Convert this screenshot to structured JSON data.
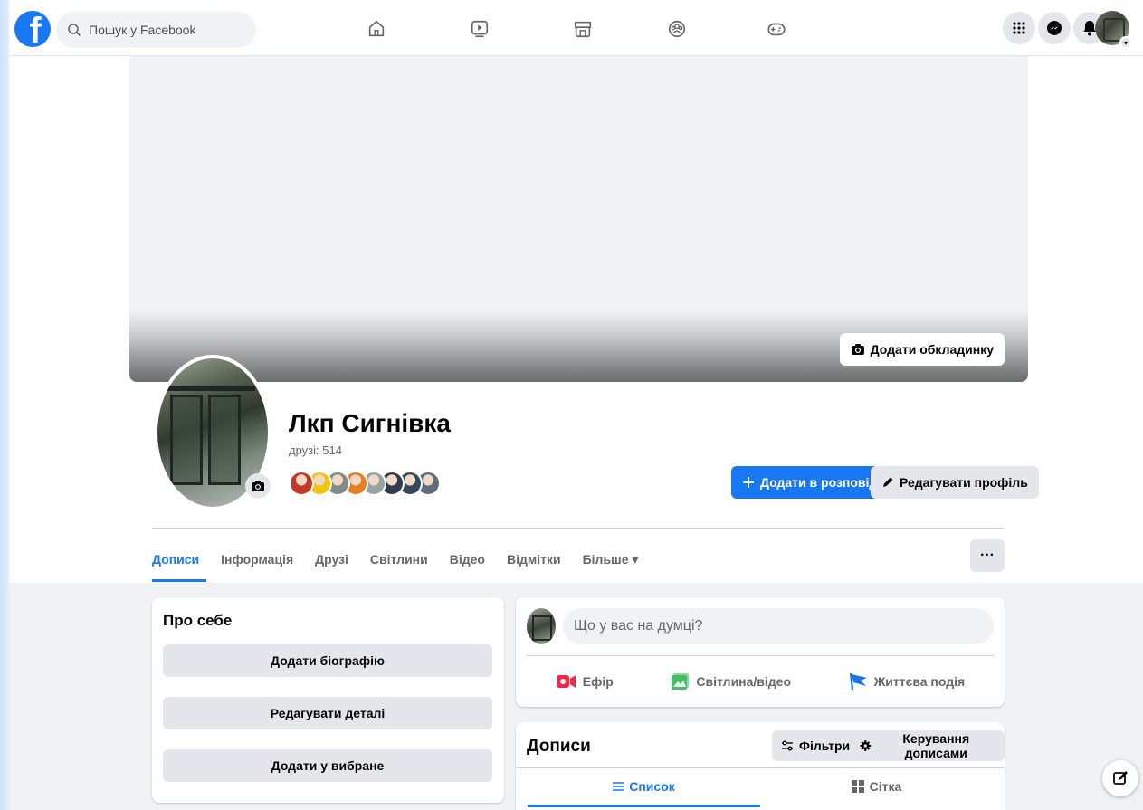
{
  "topbar": {
    "search_placeholder": "Пошук у Facebook",
    "brand_color": "#1877f2"
  },
  "cover": {
    "add_cover_label": "Додати обкладинку"
  },
  "profile": {
    "name": "Лкп Сигнівка",
    "friends_count": "друзі: 514",
    "friend_face_colors": [
      "#c0392b",
      "#f1c40f",
      "#7f8c8d",
      "#e67e22",
      "#95a5a6",
      "#2c3e50",
      "#34495e",
      "#5d6d7e"
    ],
    "add_story_label": "Додати в розповідь",
    "edit_profile_label": "Редагувати профіль"
  },
  "tabs": [
    {
      "label": "Дописи",
      "active": true
    },
    {
      "label": "Інформація"
    },
    {
      "label": "Друзі"
    },
    {
      "label": "Світлини"
    },
    {
      "label": "Відео"
    },
    {
      "label": "Відмітки"
    },
    {
      "label": "Більше ▾"
    }
  ],
  "more_menu_label": "···",
  "about": {
    "title": "Про себе",
    "add_bio_label": "Додати біографію",
    "edit_details_label": "Редагувати деталі",
    "add_featured_label": "Додати у вибране"
  },
  "composer": {
    "placeholder": "Що у вас на думці?",
    "live_label": "Ефір",
    "photo_label": "Світлина/відео",
    "life_event_label": "Життєва подія"
  },
  "posts": {
    "title": "Дописи",
    "filters_label": "Фільтри",
    "manage_label": "Керування дописами",
    "list_label": "Список",
    "grid_label": "Сітка"
  }
}
